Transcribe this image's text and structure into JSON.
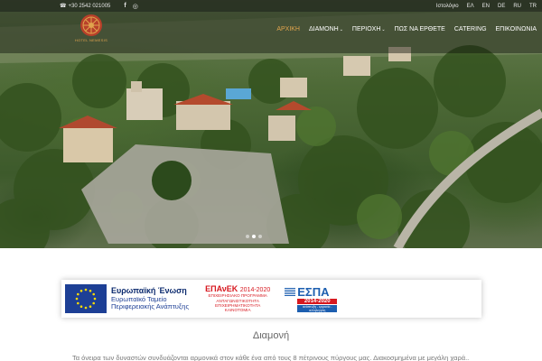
{
  "topbar": {
    "phone": "+30 2542 021005",
    "social": [
      {
        "icon": "facebook-icon",
        "glyph": "f"
      },
      {
        "icon": "instagram-icon",
        "glyph": "◎"
      }
    ],
    "blog_link": "Ιστολόγιο",
    "languages": [
      "ΕΛ",
      "EN",
      "DE",
      "RU",
      "TR"
    ]
  },
  "header": {
    "logo_text": "HOTEL NEMESIS",
    "nav": [
      {
        "label": "ΑΡΧΙΚΗ",
        "active": true,
        "dropdown": false
      },
      {
        "label": "ΔΙΑΜΟΝΗ",
        "active": false,
        "dropdown": true
      },
      {
        "label": "ΠΕΡΙΟΧΗ",
        "active": false,
        "dropdown": true
      },
      {
        "label": "ΠΩΣ ΝΑ ΕΡΘΕΤΕ",
        "active": false,
        "dropdown": false
      },
      {
        "label": "CATERING",
        "active": false,
        "dropdown": false
      },
      {
        "label": "ΕΠΙΚΟΙΝΩΝΙΑ",
        "active": false,
        "dropdown": false
      }
    ],
    "chevron": "⌄"
  },
  "slider": {
    "dots": 3,
    "active_dot": 1
  },
  "banner": {
    "eu_title": "Ευρωπαϊκή Ένωση",
    "eu_line2": "Ευρωπαϊκό Ταμείο",
    "eu_line3": "Περιφερειακής Ανάπτυξης",
    "epanek_name": "ΕΠΑνΕΚ",
    "epanek_years": "2014-2020",
    "epanek_sub1": "ΕΠΙΧΕΙΡΗΣΙΑΚΟ ΠΡΟΓΡΑΜΜΑ",
    "epanek_sub2": "ΑΝΤΑΓΩΝΙΣΤΙΚΟΤΗΤΑ",
    "epanek_sub3": "ΕΠΙΧΕΙΡΗΜΑΤΙΚΟΤΗΤΑ",
    "epanek_sub4": "ΚΑΙΝΟΤΟΜΙΑ",
    "espa_word": "ΕΣΠΑ",
    "espa_years": "2014-2020",
    "espa_slogan": "ανάπτυξη - εργασία - αλληλεγγύη"
  },
  "section": {
    "title": "Διαμονή",
    "text": "Τα όνειρα των δυναστών συνδυάζονται αρμονικά στον κάθε ένα από τους 8 πέτρινους πύργους μας. Διακοσμημένα με μεγάλη χαρά..."
  },
  "colors": {
    "accent": "#e0a44d",
    "eu_blue": "#1d3f95",
    "espa_red": "#d71920"
  }
}
